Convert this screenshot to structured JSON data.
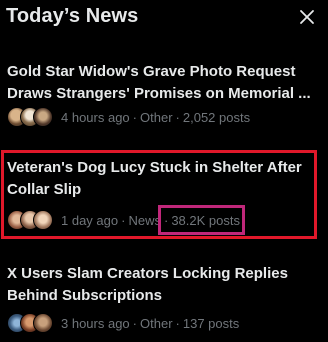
{
  "header": {
    "title": "Today’s News"
  },
  "items": [
    {
      "headline_line1": "Gold Star Widow's Grave Photo Request",
      "headline_line2": "Draws Strangers' Promises on Memorial ...",
      "time": "4 hours ago",
      "category": "Other",
      "posts": "2,052 posts"
    },
    {
      "headline_line1": "Veteran's Dog Lucy Stuck in Shelter After",
      "headline_line2": "Collar Slip",
      "time": "1 day ago",
      "category": "News",
      "posts": "38.2K posts"
    },
    {
      "headline_line1": "X Users Slam Creators Locking Replies",
      "headline_line2": "Behind Subscriptions",
      "time": "3 hours ago",
      "category": "Other",
      "posts": "137 posts"
    }
  ],
  "icons": {
    "close": "close-icon"
  },
  "colors": {
    "background": "#000000",
    "text_primary": "#e7e9ea",
    "text_secondary": "#71767b",
    "highlight_red": "#e0182a",
    "highlight_pink": "#c0277a"
  }
}
